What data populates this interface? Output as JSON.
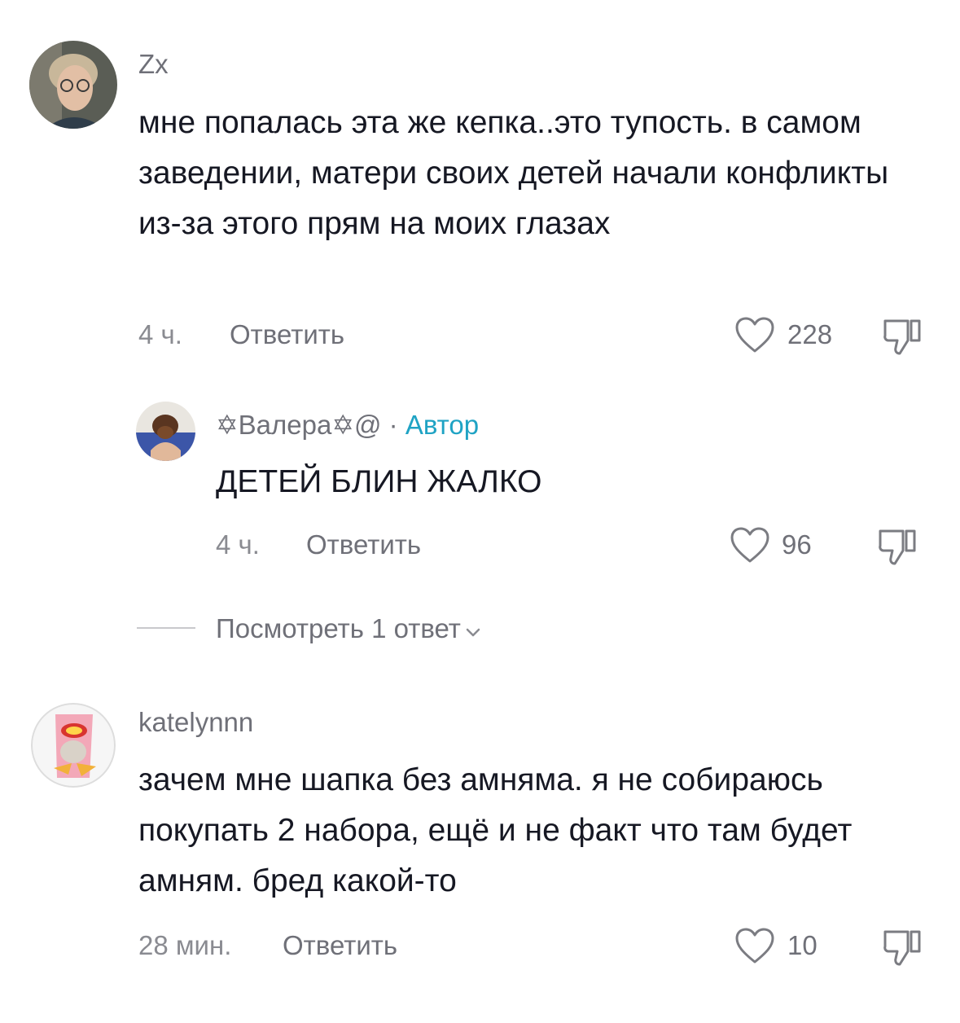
{
  "comments": [
    {
      "username": "Zx",
      "text": "мне попалась эта же кепка..это тупость. в самом заведении, матери своих детей начали конфликты из-за этого прям на моих глазах",
      "time": "4 ч.",
      "reply_label": "Ответить",
      "likes": "228",
      "avatar_icon": "avatar-zx"
    },
    {
      "username": "✡Валера✡@",
      "separator": "·",
      "author_badge": "Автор",
      "text": "ДЕТЕЙ БЛИН ЖАЛКО",
      "time": "4 ч.",
      "reply_label": "Ответить",
      "likes": "96",
      "avatar_icon": "avatar-valera"
    },
    {
      "username": "katelynnn",
      "text": "зачем мне шапка без амняма. я не собираюсь покупать 2 набора, ещё и не факт что там будет амням. бред какой-то",
      "time": "28 мин.",
      "reply_label": "Ответить",
      "likes": "10",
      "avatar_icon": "avatar-katelynnn"
    }
  ],
  "view_replies_label": "Посмотреть 1 ответ",
  "icons": {
    "like": "heart-icon",
    "dislike": "thumbs-down-icon",
    "expand": "chevron-down-icon"
  }
}
